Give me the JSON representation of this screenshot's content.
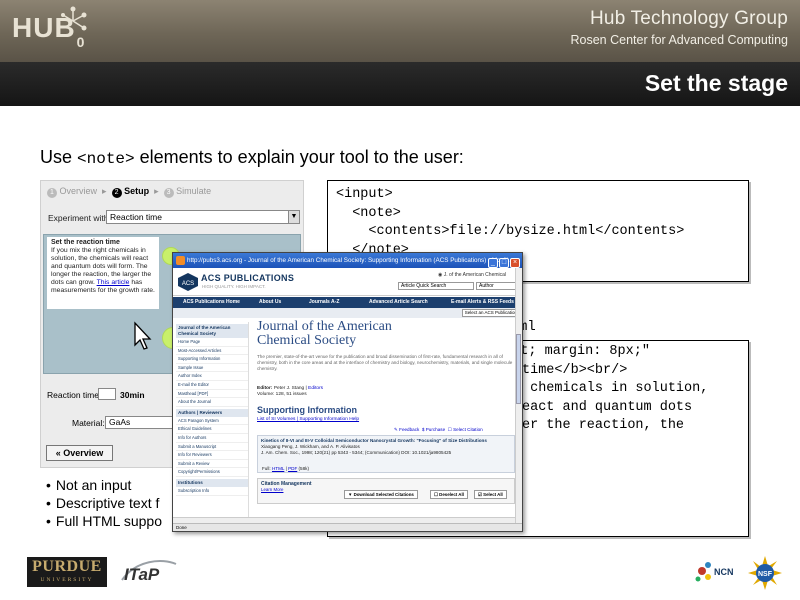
{
  "header": {
    "logo_text": "HUB",
    "logo_sub": "0",
    "org_title": "Hub Technology Group",
    "org_subtitle": "Rosen Center for Advanced Computing",
    "slide_title": "Set the stage"
  },
  "intro": {
    "before": "Use ",
    "code": "<note>",
    "after": " elements to explain your tool to the user:"
  },
  "tool": {
    "step1": "Overview",
    "step2": "Setup",
    "step3": "Simulate",
    "experiment_label": "Experiment with:",
    "experiment_value": "Reaction time",
    "note_title": "Set the reaction time",
    "note_body_1": "If you mix the right chemicals in solution, the chemicals will react and quantum dots will form. The longer the reaction, the larger the dots can grow.",
    "note_link": "This article",
    "note_body_2": "has measurements for the growth rate.",
    "reaction_label": "Reaction time:",
    "reaction_value": "30min",
    "material_label": "Material:",
    "material_value": "GaAs",
    "overview_button": "« Overview"
  },
  "code1": {
    "line1": "<input>",
    "line2": "  <note>",
    "line3": "    <contents>file://bysize.html</contents>",
    "line4": "  </note>"
  },
  "between_text": "ml",
  "code2": {
    "line1": "",
    "line2": "",
    "line3": "ight; margin: 8px;\"",
    "line4": "",
    "line5": "time</b><br/>",
    "line6": " chemicals in solution,",
    "line7": "eact and quantum dots",
    "line8": "er the reaction, the"
  },
  "bullets": [
    "Not an input",
    "Descriptive text f",
    "Full HTML suppo"
  ],
  "browser": {
    "title": "http://pubs3.acs.org - Journal of the American Chemical Society: Supporting Information (ACS Publications) - Mozill...",
    "acs_name": "ACS PUBLICATIONS",
    "acs_tag": "HIGH QUALITY. HIGH IMPACT.",
    "radio_label": "J. of the American Chemical",
    "quick_search": "Article Quick Search",
    "author_field": "Author",
    "nav": [
      "ACS Publications Home",
      "About Us",
      "Journals A-Z",
      "Advanced Article Search",
      "E-mail Alerts & RSS Feeds"
    ],
    "select_pub": "Select an ACS Publication",
    "sidebar_head1": "Journal of the American Chemical Society",
    "sidebar_items1": [
      "Home Page",
      "Most-Accessed Articles",
      "Supporting Information",
      "Sample Issue",
      "Author Index",
      "E-mail the Editor",
      "Masthead [PDF]",
      "About the Journal"
    ],
    "sidebar_head2": "Authors | Reviewers",
    "sidebar_items2": [
      "ACS Paragon System",
      "Ethical Guidelines",
      "Info for Authors",
      "Submit a Manuscript",
      "Info for Reviewers",
      "Submit a Review",
      "Copyright/Permissions"
    ],
    "sidebar_head3": "Institutions",
    "sidebar_items3": [
      "Subscription Info"
    ],
    "journal_line1": "Journal of the American",
    "journal_line2": "Chemical Society",
    "journal_desc": "The premier, state-of-the-art venue for the publication and broad dissemination of first-rate, fundamental research in all of chemistry, both in the core areas and at the interface of chemistry and biology, neurochemistry, materials, and single molecule chemistry.",
    "editor_label": "Editor:",
    "editor_name": "Peter J. Stang",
    "editors_link": "Editors",
    "volume": "Volume: 128, 51 issues",
    "si_title": "Supporting Information",
    "si_link1": "List of SI Volumes",
    "si_link2": "Supporting Information Help",
    "feedback": "Feedback",
    "purchase": "Purchase",
    "select_citation": "Select Citation",
    "article_title": "Kinetics of II-VI and III-V Colloidal Semiconductor Nanocrystal Growth: \"Focusing\" of Size Distributions",
    "article_authors": "Xiaogang Peng, J. Wickham, and A. P. Alivisatos",
    "article_ref": "J. Am. Chem. Soc., 1998; 120(21) pp 5343 - 5344; (Communication) DOI: 10.1021/ja9805425",
    "full_label": "Full:",
    "html_link": "HTML",
    "pdf_link": "PDF",
    "pdf_size": "(58k)",
    "cit_title": "Citation Management",
    "learn_more": "Learn More",
    "btn_download": "Download Selected Citations",
    "btn_deselect": "Deselect All",
    "btn_select": "Select All",
    "status": "Done"
  },
  "footer": {
    "purdue": "PURDUE",
    "purdue_sub": "UNIVERSITY",
    "itap": "ITaP",
    "ncn": "NCN",
    "nsf": "NSF"
  }
}
